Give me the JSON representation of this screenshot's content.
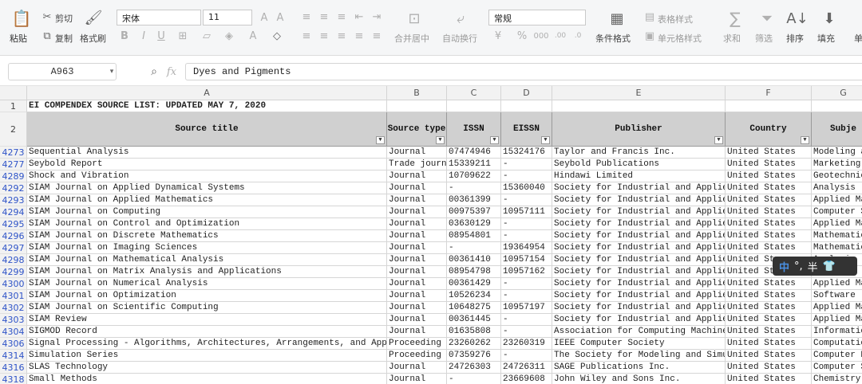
{
  "ribbon": {
    "paste": "粘贴",
    "cut": "剪切",
    "copy": "复制",
    "format_painter": "格式刷",
    "font_name": "宋体",
    "font_size": "11",
    "merge_center": "合并居中",
    "wrap_text": "自动换行",
    "number_format": "常规",
    "conditional_format": "条件格式",
    "table_style": "表格样式",
    "cell_style": "单元格样式",
    "sum": "求和",
    "filter": "筛选",
    "sort": "排序",
    "fill": "填充",
    "more": "单"
  },
  "formula_bar": {
    "name_box": "A963",
    "fx": "fx",
    "value": "Dyes and Pigments"
  },
  "columns": [
    "A",
    "B",
    "C",
    "D",
    "E",
    "F",
    "G"
  ],
  "sheet_title": "EI COMPENDEX SOURCE LIST: UPDATED MAY 7, 2020",
  "headers": [
    "Source title",
    "Source type",
    "ISSN",
    "EISSN",
    "Publisher",
    "Country",
    "Subje"
  ],
  "rows": [
    {
      "n": "4273",
      "a": "Sequential Analysis",
      "b": "Journal",
      "c": "07474946",
      "d": "15324176",
      "e": "Taylor and Francis Inc.",
      "f": "United States",
      "g": "Modeling a"
    },
    {
      "n": "4277",
      "a": "Seybold Report",
      "b": "Trade journa",
      "c": "15339211",
      "d": "-",
      "e": "Seybold Publications",
      "f": "United States",
      "g": "Marketing"
    },
    {
      "n": "4289",
      "a": "Shock and Vibration",
      "b": "Journal",
      "c": "10709622",
      "d": "-",
      "e": "Hindawi Limited",
      "f": "United States",
      "g": "Geotechnic"
    },
    {
      "n": "4292",
      "a": "SIAM Journal on Applied Dynamical Systems",
      "b": "Journal",
      "c": "-",
      "d": "15360040",
      "e": "Society for Industrial and Applied M",
      "f": "United States",
      "g": "Analysis"
    },
    {
      "n": "4293",
      "a": "SIAM Journal on Applied Mathematics",
      "b": "Journal",
      "c": "00361399",
      "d": "-",
      "e": "Society for Industrial and Applied M",
      "f": "United States",
      "g": "Applied Ma"
    },
    {
      "n": "4294",
      "a": "SIAM Journal on Computing",
      "b": "Journal",
      "c": "00975397",
      "d": "10957111",
      "e": "Society for Industrial and Applied M",
      "f": "United States",
      "g": "Computer S"
    },
    {
      "n": "4295",
      "a": "SIAM Journal on Control and Optimization",
      "b": "Journal",
      "c": "03630129",
      "d": "-",
      "e": "Society for Industrial and Applied M",
      "f": "United States",
      "g": "Applied Ma"
    },
    {
      "n": "4296",
      "a": "SIAM Journal on Discrete Mathematics",
      "b": "Journal",
      "c": "08954801",
      "d": "-",
      "e": "Society for Industrial and Applied M",
      "f": "United States",
      "g": "Mathematic"
    },
    {
      "n": "4297",
      "a": "SIAM Journal on Imaging Sciences",
      "b": "Journal",
      "c": "-",
      "d": "19364954",
      "e": "Society for Industrial and Applied M",
      "f": "United States",
      "g": "Mathematic"
    },
    {
      "n": "4298",
      "a": "SIAM Journal on Mathematical Analysis",
      "b": "Journal",
      "c": "00361410",
      "d": "10957154",
      "e": "Society for Industrial and Applied M",
      "f": "United St",
      "g": "Analysis"
    },
    {
      "n": "4299",
      "a": "SIAM Journal on Matrix Analysis and Applications",
      "b": "Journal",
      "c": "08954798",
      "d": "10957162",
      "e": "Society for Industrial and Applied M",
      "f": "United St",
      "g": "Analysis"
    },
    {
      "n": "4300",
      "a": "SIAM Journal on Numerical Analysis",
      "b": "Journal",
      "c": "00361429",
      "d": "-",
      "e": "Society for Industrial and Applied M",
      "f": "United States",
      "g": "Applied Ma"
    },
    {
      "n": "4301",
      "a": "SIAM Journal on Optimization",
      "b": "Journal",
      "c": "10526234",
      "d": "-",
      "e": "Society for Industrial and Applied M",
      "f": "United States",
      "g": "Software"
    },
    {
      "n": "4302",
      "a": "SIAM Journal on Scientific Computing",
      "b": "Journal",
      "c": "10648275",
      "d": "10957197",
      "e": "Society for Industrial and Applied M",
      "f": "United States",
      "g": "Applied Ma"
    },
    {
      "n": "4303",
      "a": "SIAM Review",
      "b": "Journal",
      "c": "00361445",
      "d": "-",
      "e": "Society for Industrial and Applied M",
      "f": "United States",
      "g": "Applied Ma"
    },
    {
      "n": "4304",
      "a": "SIGMOD Record",
      "b": "Journal",
      "c": "01635808",
      "d": "-",
      "e": "Association for Computing Machinery",
      "f": "United States",
      "g": "Informatio"
    },
    {
      "n": "4306",
      "a": "Signal Processing - Algorithms, Architectures, Arrangements, and Applicatio",
      "b": "Proceeding",
      "c": "23260262",
      "d": "23260319",
      "e": "IEEE Computer Society",
      "f": "United States",
      "g": "Computatio"
    },
    {
      "n": "4314",
      "a": "Simulation Series",
      "b": "Proceeding",
      "c": "07359276",
      "d": "-",
      "e": "The Society for Modeling and Simulat",
      "f": "United States",
      "g": "Computer N"
    },
    {
      "n": "4316",
      "a": "SLAS Technology",
      "b": "Journal",
      "c": "24726303",
      "d": "24726311",
      "e": "SAGE Publications Inc.",
      "f": "United States",
      "g": "Computer S"
    },
    {
      "n": "4318",
      "a": "Small Methods",
      "b": "Journal",
      "c": "-",
      "d": "23669608",
      "e": "John Wiley and Sons Inc.",
      "f": "United States",
      "g": "Chemistry"
    }
  ],
  "ime": {
    "lang": "中",
    "punct": "°,",
    "width": "半"
  }
}
